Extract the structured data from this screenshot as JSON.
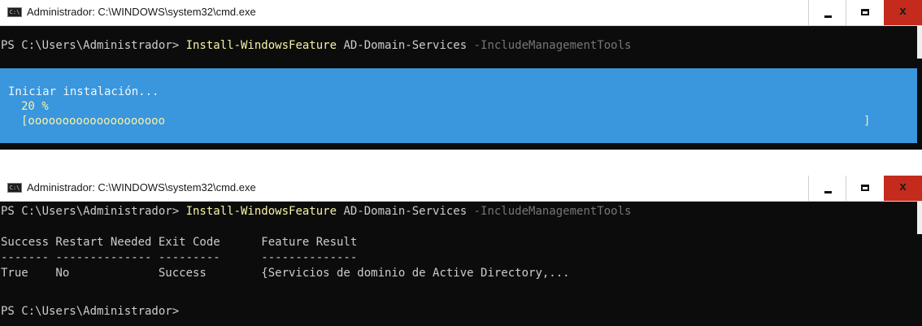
{
  "top_window": {
    "title": "Administrador: C:\\WINDOWS\\system32\\cmd.exe",
    "icon_label": "C:\\",
    "command": {
      "prompt": "PS C:\\Users\\Administrador> ",
      "cmdlet": "Install-WindowsFeature",
      "argument": " AD-Domain-Services ",
      "parameter": "-IncludeManagementTools"
    },
    "progress": {
      "status": "Iniciar instalación...",
      "percent_text": "20 %",
      "percent": 20,
      "bar_fill": "[oooooooooooooooooooo",
      "bar_end": "]"
    }
  },
  "bottom_window": {
    "title": "Administrador: C:\\WINDOWS\\system32\\cmd.exe",
    "icon_label": "C:\\",
    "command": {
      "prompt": "PS C:\\Users\\Administrador> ",
      "cmdlet": "Install-WindowsFeature",
      "argument": " AD-Domain-Services ",
      "parameter": "-IncludeManagementTools"
    },
    "table": {
      "header_line": "Success Restart Needed Exit Code      Feature Result",
      "underline_line": "------- -------------- ---------      --------------",
      "rows": [
        "True    No             Success        {Servicios de dominio de Active Directory,..."
      ]
    },
    "final_prompt": "PS C:\\Users\\Administrador>"
  },
  "window_controls": {
    "minimize_label": "",
    "maximize_label": "",
    "close_label": "x"
  },
  "colors": {
    "console_background": "#0c0c0c",
    "console_text": "#cccccc",
    "cmdlet_yellow": "#f9f1a5",
    "parameter_gray": "#767676",
    "progress_background": "#3a96dd",
    "close_button_red": "#c42b1c"
  }
}
